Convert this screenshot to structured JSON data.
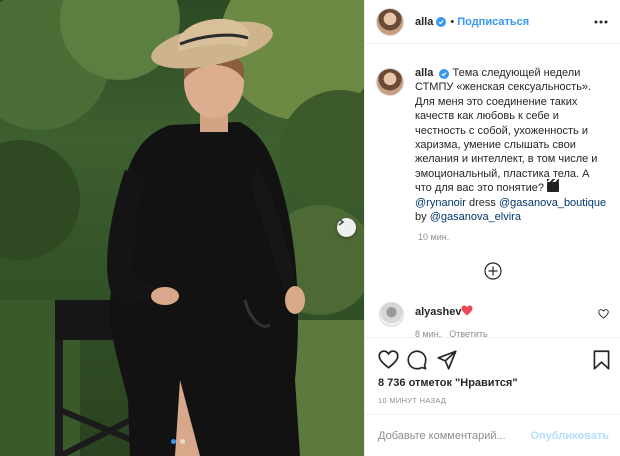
{
  "post": {
    "author": "alla",
    "follow_separator": "•",
    "follow_label": "Подписаться",
    "more_icon": "more-horizontal-icon"
  },
  "caption": {
    "author": "alla",
    "lines": [
      "Тема следующей недели",
      "СТМПУ «женская сексуальность».",
      "Для меня это соединение таких",
      "качеств как любовь к себе и",
      "честность с собой, ухоженность и",
      "харизма, умение слышать свои",
      "желания и интеллект, в том числе и",
      "эмоциональный, пластика тела. А",
      "что для вас это понятие?"
    ],
    "emoji": "clapper-board-emoji",
    "mention_1": "@rynanoir",
    "word_dress": "dress",
    "mention_2": "@gasanova_boutique",
    "word_by": "by",
    "mention_3": "@gasanova_elvira",
    "time": "10 мин."
  },
  "comments": [
    {
      "user": "alyashev",
      "emoji": "red-heart-emoji",
      "time": "8 мин.",
      "reply_label": "Ответить"
    }
  ],
  "actions": {
    "icons": [
      "heart-icon",
      "comment-icon",
      "share-icon",
      "bookmark-icon"
    ]
  },
  "likes_text": "8 736 отметок \"Нравится\"",
  "posted_ago": "10 МИНУТ НАЗАД",
  "add_comment": {
    "placeholder": "Добавьте комментарий...",
    "publish_label": "Опубликовать"
  },
  "carousel": {
    "current": 1,
    "total": 2
  },
  "colors": {
    "accent": "#3897f0",
    "publish_disabled": "#b2dffc",
    "heart": "#ed4956",
    "muted": "#8e8e8e"
  }
}
